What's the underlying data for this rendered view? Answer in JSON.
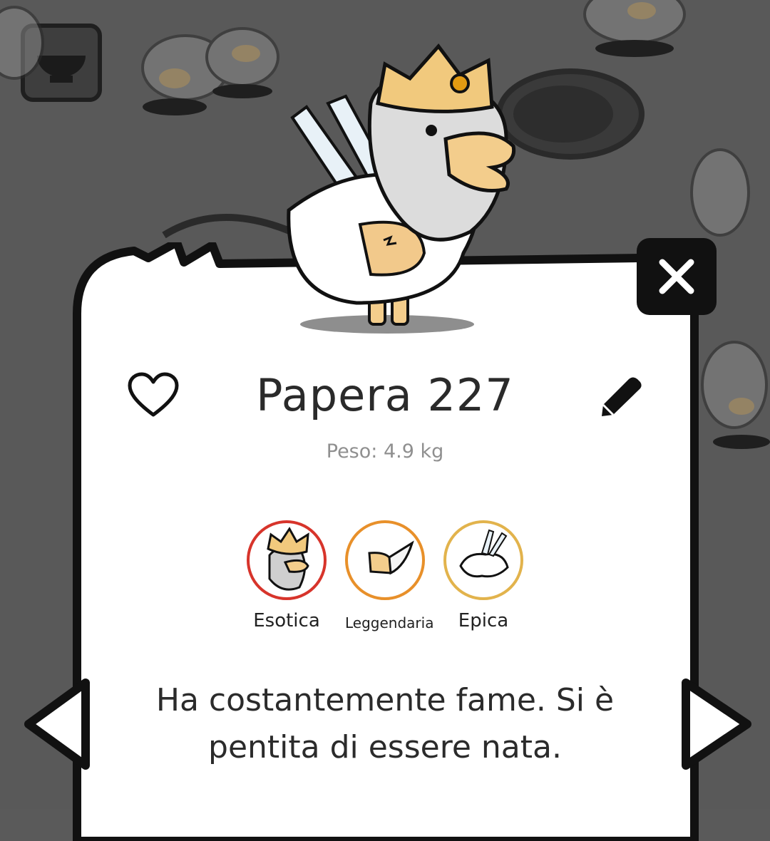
{
  "duck": {
    "name": "Papera 227",
    "weight": "Peso: 4.9 kg",
    "description": "Ha costantemente fame. Si è pentita di essere nata."
  },
  "traits": [
    {
      "label": "Esotica",
      "ring_color": "#d7342b",
      "icon": "crown-beard-icon"
    },
    {
      "label": "Leggendaria",
      "ring_color": "#e8902a",
      "icon": "beak-horn-icon"
    },
    {
      "label": "Epica",
      "ring_color": "#e2b34c",
      "icon": "wings-icon"
    }
  ],
  "icons": {
    "close": "close-icon",
    "favorite": "heart-icon",
    "rename": "pencil-icon",
    "prev": "arrow-left-icon",
    "next": "arrow-right-icon",
    "food": "bowl-icon"
  }
}
